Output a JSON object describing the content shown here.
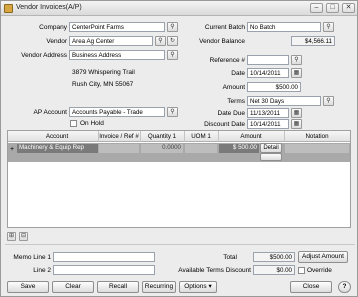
{
  "window": {
    "title": "Vendor Invoices(A/P)",
    "icon": "invoice-icon"
  },
  "form": {
    "company_label": "Company",
    "company_value": "CenterPoint Farms",
    "vendor_label": "Vendor",
    "vendor_value": "Area Ag Center",
    "vendor_address_label": "Vendor Address",
    "vendor_address_value": "Business Address",
    "address_line1": "3879 Whispering Trail",
    "address_line2": "Rush City, MN  55067",
    "ap_account_label": "AP Account",
    "ap_account_value": "Accounts Payable - Trade",
    "on_hold_label": "On Hold",
    "current_batch_label": "Current Batch",
    "current_batch_value": "No Batch",
    "vendor_balance_label": "Vendor Balance",
    "vendor_balance_value": "$4,566.11",
    "reference_label": "Reference #",
    "reference_value": "",
    "date_label": "Date",
    "date_value": "10/14/2011",
    "amount_label": "Amount",
    "amount_value": "$500.00",
    "terms_label": "Terms",
    "terms_value": "Net 30 Days",
    "date_due_label": "Date Due",
    "date_due_value": "11/13/2011",
    "discount_date_label": "Discount Date",
    "discount_date_value": "10/14/2011"
  },
  "grid": {
    "columns": [
      "Account",
      "Invoice / Ref #",
      "Quantity 1",
      "UOM 1",
      "Amount",
      "Notation"
    ],
    "rows": [
      {
        "expand": "+",
        "account": "Machinery & Equip Rep",
        "invoice_ref": "",
        "quantity": "0.0000",
        "uom": "",
        "amount": "$ 500.00",
        "detail_label": "Detail",
        "notation": ""
      }
    ]
  },
  "footer": {
    "memo_line1_label": "Memo Line 1",
    "memo_line1_value": "",
    "line2_label": "Line 2",
    "line2_value": "",
    "total_label": "Total",
    "total_value": "$500.00",
    "adjust_amount_label": "Adjust Amount",
    "terms_discount_label": "Available Terms Discount",
    "terms_discount_value": "$0.00",
    "override_label": "Override"
  },
  "buttons": {
    "save": "Save",
    "clear": "Clear",
    "recall": "Recall",
    "recurring": "Recurring",
    "options": "Options",
    "close": "Close"
  },
  "icons": {
    "lookup": "magnifier-icon",
    "calendar": "calendar-icon",
    "add_row": "add-row-icon",
    "delete_row": "delete-row-icon",
    "help": "help-icon"
  }
}
